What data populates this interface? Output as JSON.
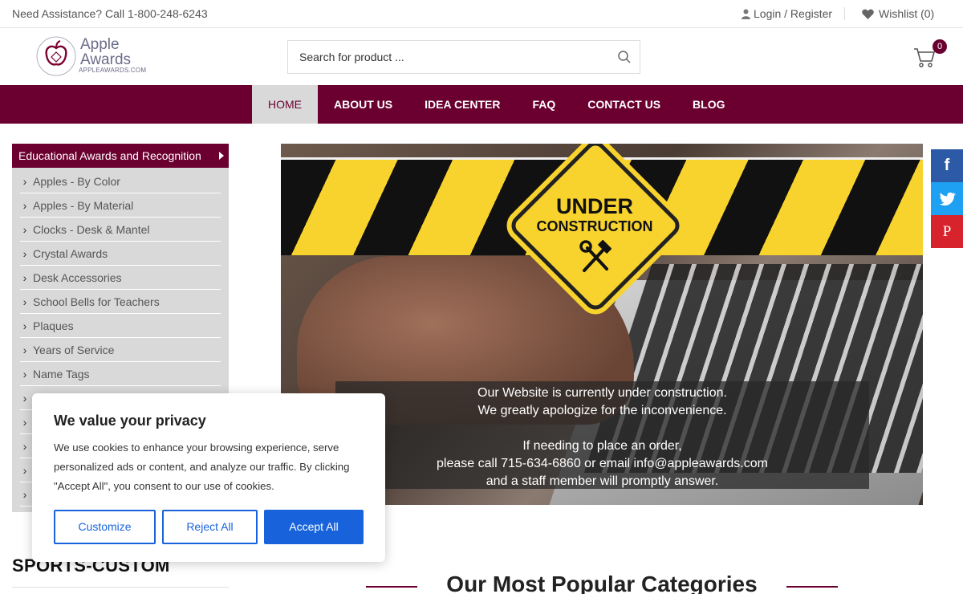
{
  "topbar": {
    "assistance": "Need Assistance? Call 1-800-248-6243",
    "login": "Login / Register",
    "wishlist": "Wishlist (0)"
  },
  "header": {
    "logo_line1": "Apple",
    "logo_line2": "Awards",
    "logo_url": "APPLEAWARDS.COM",
    "search_placeholder": "Search for product ...",
    "cart_count": "0"
  },
  "nav": {
    "items": [
      {
        "label": "HOME",
        "active": true
      },
      {
        "label": "ABOUT US"
      },
      {
        "label": "IDEA CENTER"
      },
      {
        "label": "FAQ"
      },
      {
        "label": "CONTACT US"
      },
      {
        "label": "BLOG"
      }
    ]
  },
  "sidebar": {
    "heading": "Educational Awards and Recognition",
    "items": [
      {
        "label": "Apples - By Color"
      },
      {
        "label": "Apples - By Material"
      },
      {
        "label": "Clocks - Desk & Mantel"
      },
      {
        "label": "Crystal Awards"
      },
      {
        "label": "Desk Accessories"
      },
      {
        "label": "School Bells for Teachers"
      },
      {
        "label": "Plaques"
      },
      {
        "label": "Years of Service"
      },
      {
        "label": "Name Tags"
      },
      {
        "label": ""
      },
      {
        "label": ""
      },
      {
        "label": ""
      },
      {
        "label": ""
      },
      {
        "label": ""
      }
    ]
  },
  "banner": {
    "sign_line1": "UNDER",
    "sign_line2": "CONSTRUCTION",
    "message": [
      "Our Website is currently under construction.",
      "We greatly apologize for the inconvenience.",
      "",
      "If needing to place an order,",
      "please call 715-634-6860 or email info@appleawards.com",
      "and a staff member will promptly answer."
    ]
  },
  "share": {
    "facebook": "f",
    "pinterest": "P"
  },
  "bottom": {
    "sports_heading": "SPORTS-CUSTOM",
    "popular_heading": "Our Most Popular Categories"
  },
  "cookie": {
    "title": "We value your privacy",
    "body": "We use cookies to enhance your browsing experience, serve personalized ads or content, and analyze our traffic. By clicking \"Accept All\", you consent to our use of cookies.",
    "customize": "Customize",
    "reject": "Reject All",
    "accept": "Accept All"
  },
  "colors": {
    "brand": "#6b0030",
    "sidebar_bg": "#d9d9d9",
    "cookie_blue": "#1863dc",
    "facebook": "#2d5aa7",
    "twitter": "#1ea1f2",
    "pinterest": "#d7242c"
  }
}
